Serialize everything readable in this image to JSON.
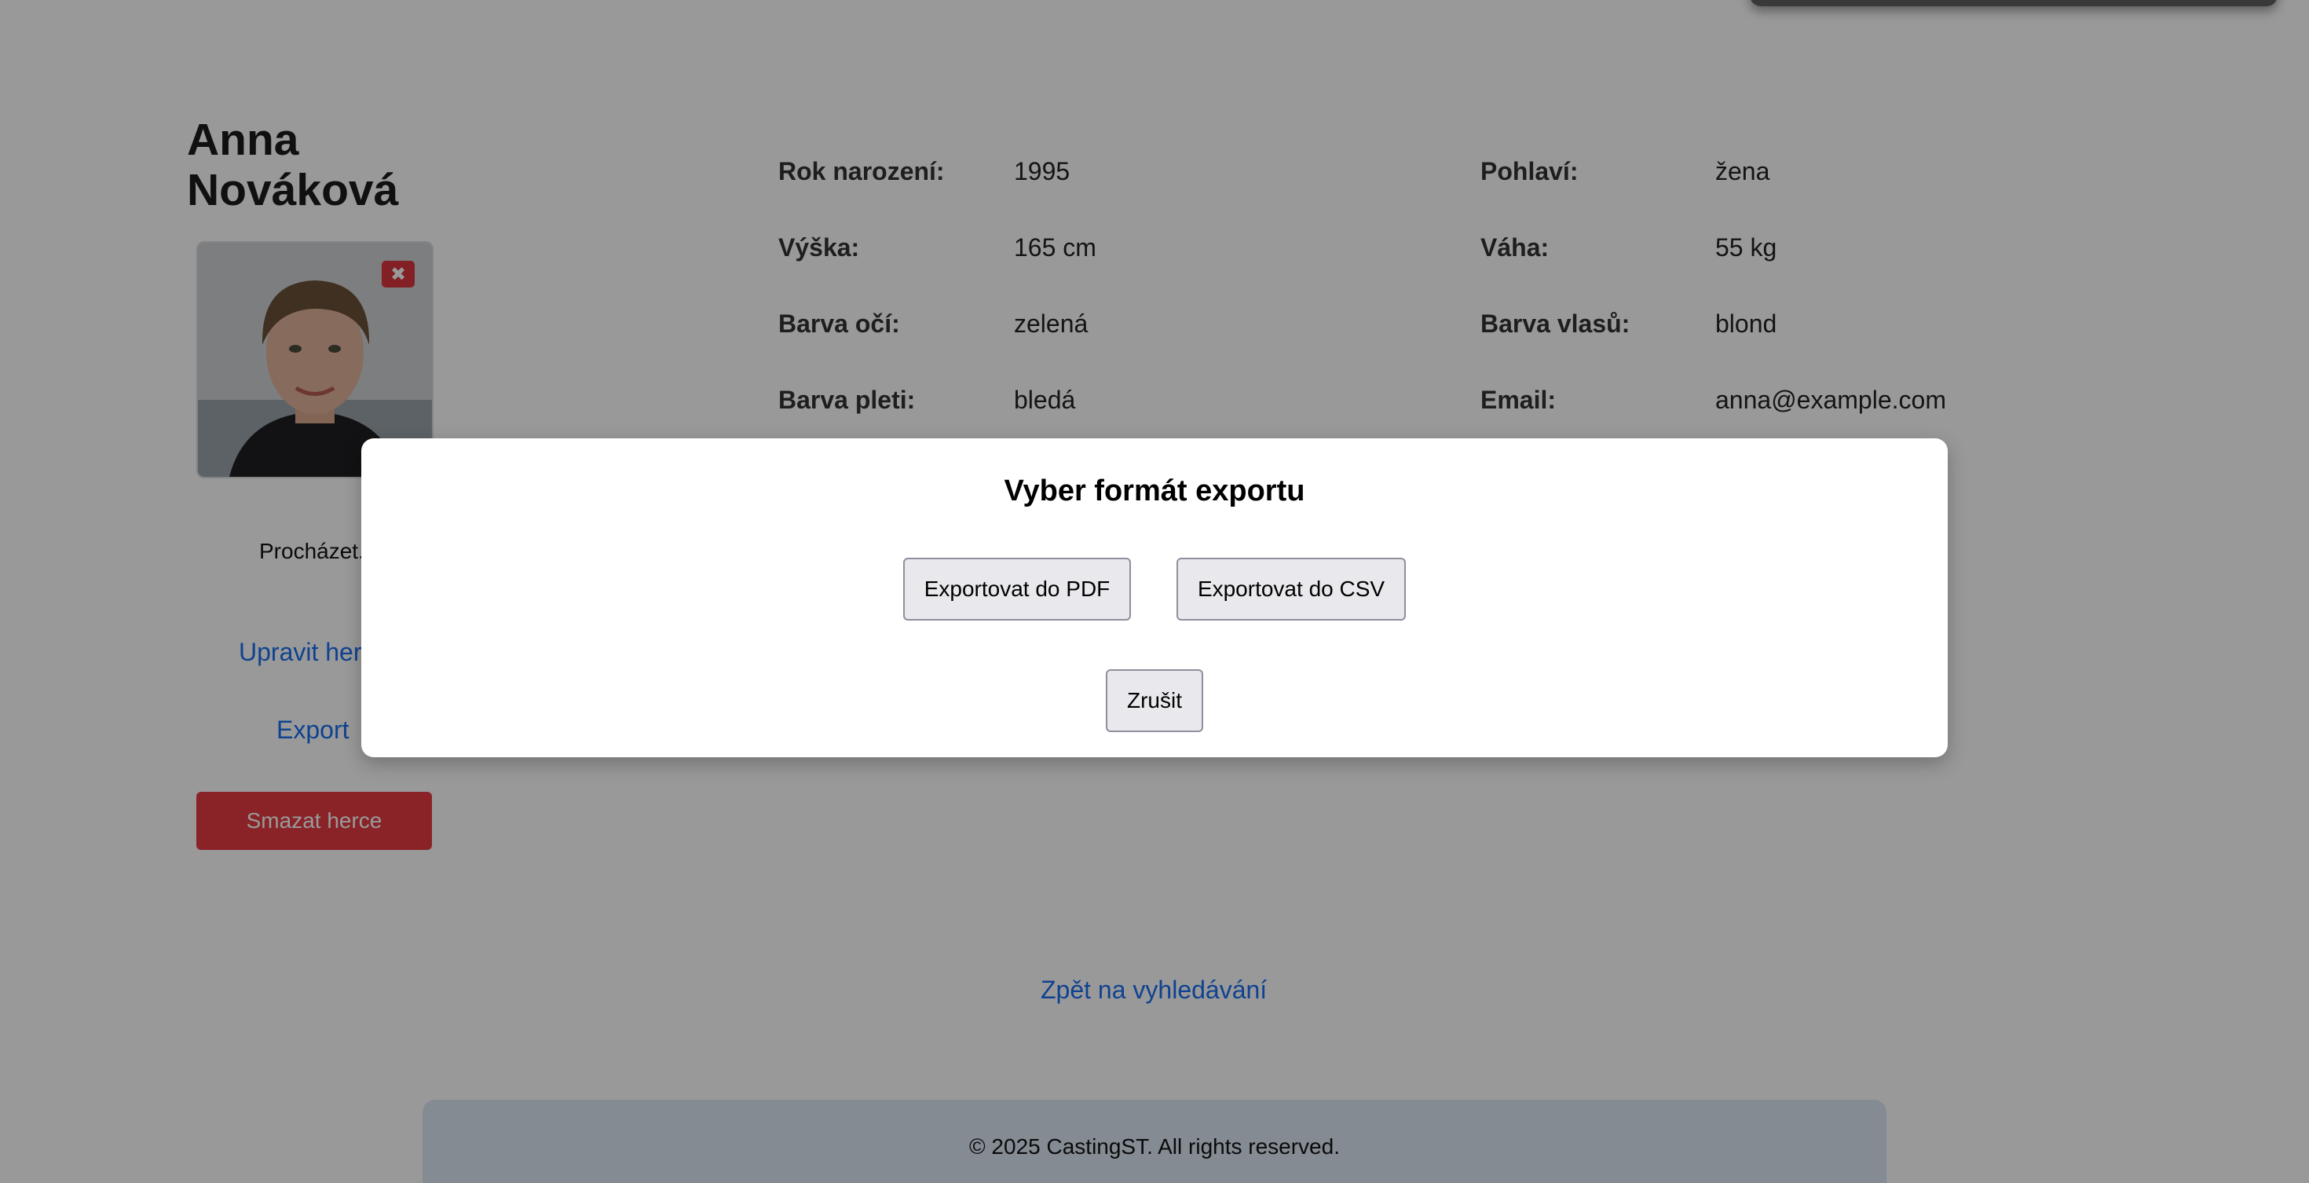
{
  "actor": {
    "first_name": "Anna",
    "last_name": "Nováková",
    "photo_remove_symbol": "✖"
  },
  "sidebar": {
    "browse_label": "Procházet...",
    "edit_link": "Upravit herce",
    "export_link": "Export",
    "delete_button": "Smazat herce"
  },
  "details": {
    "left": [
      {
        "label": "Rok narození:",
        "value": "1995"
      },
      {
        "label": "Výška:",
        "value": "165 cm"
      },
      {
        "label": "Barva očí:",
        "value": "zelená"
      },
      {
        "label": "Barva pleti:",
        "value": "bledá"
      }
    ],
    "right": [
      {
        "label": "Pohlaví:",
        "value": "žena"
      },
      {
        "label": "Váha:",
        "value": "55 kg"
      },
      {
        "label": "Barva vlasů:",
        "value": "blond"
      },
      {
        "label": "Email:",
        "value": "anna@example.com"
      }
    ]
  },
  "back_link": "Zpět na vyhledávání",
  "footer": {
    "text": "© 2025 CastingST. All rights reserved."
  },
  "modal": {
    "title": "Vyber formát exportu",
    "pdf_button": "Exportovat do PDF",
    "csv_button": "Exportovat do CSV",
    "cancel_button": "Zrušit"
  },
  "colors": {
    "link": "#1a6ff0",
    "delete": "#e53b42",
    "footer_bg": "#dde8f5",
    "overlay": "rgba(0,0,0,0.4)"
  },
  "icons": {
    "photo_remove": "close-icon"
  }
}
